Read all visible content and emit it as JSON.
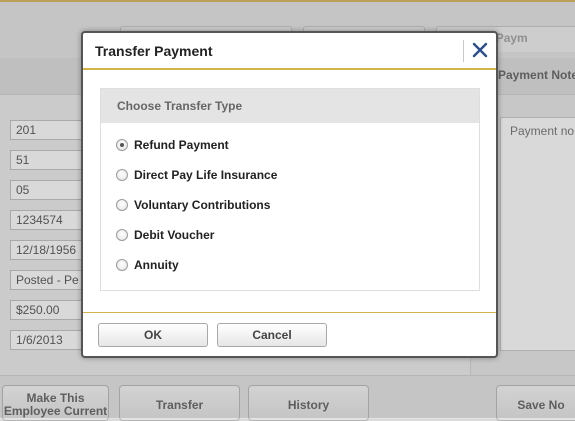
{
  "background": {
    "tabs": [
      "",
      "",
      "Selected Paym"
    ],
    "right_panel_label": "Payment Note",
    "fields": [
      "201",
      "51",
      "05",
      "1234574",
      "12/18/1956",
      "Posted - Pe",
      "$250.00",
      "1/6/2013"
    ],
    "notes_placeholder": "Payment no",
    "buttons": {
      "make_current_line1": "Make This",
      "make_current_line2": "Employee Current",
      "transfer": "Transfer",
      "history": "History",
      "save_note": "Save No"
    }
  },
  "dialog": {
    "title": "Transfer Payment",
    "close_icon": "close-icon",
    "section_title": "Choose Transfer Type",
    "options": [
      {
        "label": "Refund Payment",
        "checked": true
      },
      {
        "label": "Direct Pay Life Insurance",
        "checked": false
      },
      {
        "label": "Voluntary Contributions",
        "checked": false
      },
      {
        "label": "Debit Voucher",
        "checked": false
      },
      {
        "label": "Annuity",
        "checked": false
      }
    ],
    "ok_label": "OK",
    "cancel_label": "Cancel"
  },
  "colors": {
    "accent_gold": "#d4b24c",
    "close_icon": "#2a4f8a"
  }
}
